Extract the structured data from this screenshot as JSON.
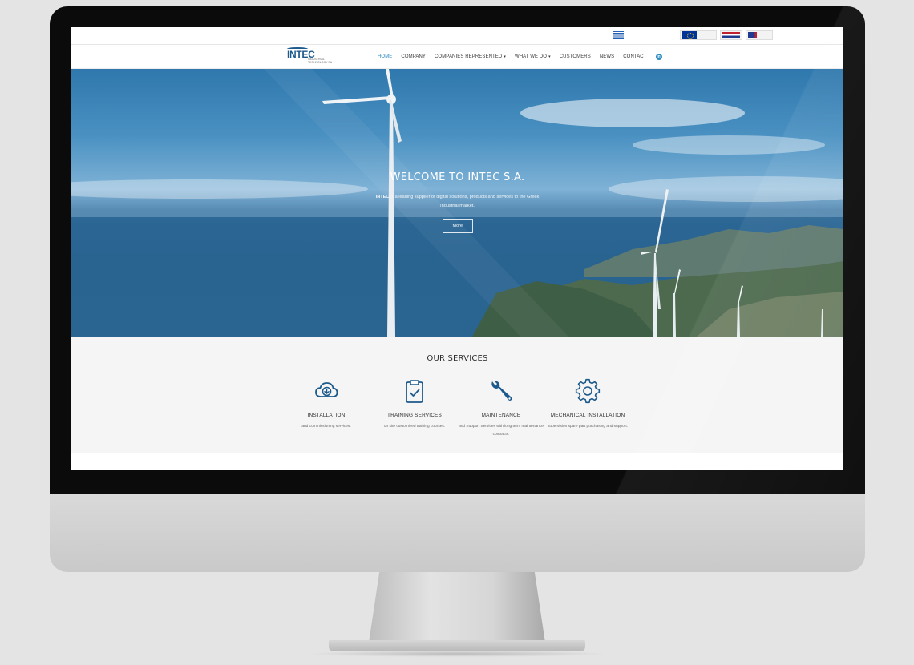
{
  "nav": {
    "logo_text": "INTEC",
    "logo_sub_line1": "INDUSTRIAL",
    "logo_sub_line2": "TECHNOLOGY SA",
    "items": [
      {
        "label": "HOME",
        "active": true
      },
      {
        "label": "COMPANY"
      },
      {
        "label": "COMPANIES REPRESENTED",
        "dropdown": true
      },
      {
        "label": "WHAT WE DO",
        "dropdown": true
      },
      {
        "label": "CUSTOMERS"
      },
      {
        "label": "NEWS"
      },
      {
        "label": "CONTACT"
      }
    ],
    "social_icon": "linkedin-icon",
    "linkedin_label": "in"
  },
  "hero": {
    "title": "WELCOME TO INTEC S.A.",
    "text_bold": "INTEC",
    "text": " is a leading supplier of digital solutions, products and services to the Greek Industrial market.",
    "button_label": "More"
  },
  "services": {
    "title": "OUR SERVICES",
    "items": [
      {
        "icon": "cloud-download-icon",
        "title": "INSTALLATION",
        "desc": "and commissioning services."
      },
      {
        "icon": "clipboard-check-icon",
        "title": "TRAINING SERVICES",
        "desc": "on site customized training courses."
      },
      {
        "icon": "wrench-icon",
        "title": "MAINTENANCE",
        "desc": "and Support Services with long term maintenance contracts."
      },
      {
        "icon": "gear-icon",
        "title": "MECHANICAL INSTALLATION",
        "desc": "supervision spare part purchasing and support."
      }
    ]
  },
  "colors": {
    "accent": "#2a8ac2",
    "icon_blue": "#1d5a8c"
  }
}
